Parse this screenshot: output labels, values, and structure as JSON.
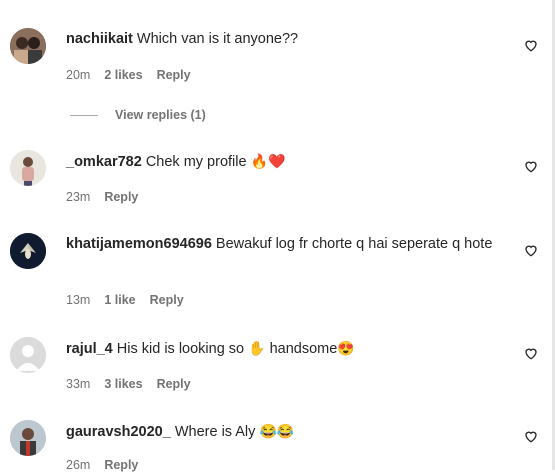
{
  "comments": [
    {
      "username": "nachiikait",
      "text": "Which van is it anyone??",
      "time": "20m",
      "likes": "2 likes",
      "reply": "Reply",
      "view_replies": "View replies (1)"
    },
    {
      "username": "_omkar782",
      "text": "Chek my profile",
      "emoji": "🔥❤️",
      "time": "23m",
      "likes": "",
      "reply": "Reply"
    },
    {
      "username": "khatijamemon694696",
      "text": "Bewakuf log fr chorte q hai seperate q hote",
      "time": "13m",
      "likes": "1 like",
      "reply": "Reply"
    },
    {
      "username": "rajul_4",
      "text_before": "His kid is looking so",
      "emoji_mid": "✋",
      "text_after": "handsome",
      "emoji_end": "😍",
      "time": "33m",
      "likes": "3 likes",
      "reply": "Reply"
    },
    {
      "username": "gauravsh2020_",
      "text": "Where is Aly",
      "emoji": "😂😂",
      "time": "26m",
      "likes": "",
      "reply": "Reply"
    }
  ],
  "icons": {
    "like": "heart-outline-icon"
  },
  "colors": {
    "text": "#262626",
    "meta": "#737373"
  }
}
